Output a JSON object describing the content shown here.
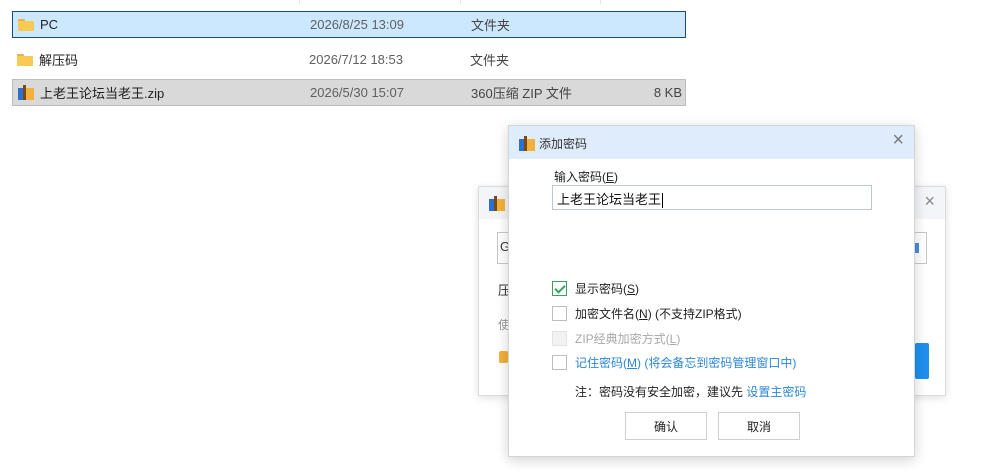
{
  "files": [
    {
      "name": "PC",
      "date": "2026/8/25 13:09",
      "type": "文件夹",
      "size": "",
      "icon": "folder-icon",
      "state": "selected"
    },
    {
      "name": "解压码",
      "date": "2026/7/12 18:53",
      "type": "文件夹",
      "size": "",
      "icon": "folder-icon",
      "state": "normal"
    },
    {
      "name": "上老王论坛当老王.zip",
      "date": "2026/5/30 15:07",
      "type": "360压缩 ZIP 文件",
      "size": "8 KB",
      "icon": "zip-archive-icon",
      "state": "hover"
    }
  ],
  "bg_dialog": {
    "close": "×",
    "input_partial": "G",
    "label_partial": "压",
    "hint_partial": "使"
  },
  "dialog": {
    "title": "添加密码",
    "close": "×",
    "password_label": "输入密码",
    "password_label_key": "E",
    "password_value": "上老王论坛当老王",
    "options": [
      {
        "text": "显示密码",
        "key": "S",
        "suffix": "",
        "checked": true,
        "disabled": false,
        "link": false
      },
      {
        "text": "加密文件名",
        "key": "N",
        "suffix": " (不支持ZIP格式)",
        "checked": false,
        "disabled": false,
        "link": false
      },
      {
        "text": "ZIP经典加密方式",
        "key": "L",
        "suffix": "",
        "checked": false,
        "disabled": true,
        "link": false
      },
      {
        "text": "记住密码",
        "key": "M",
        "suffix": " (将会备忘到密码管理窗口中)",
        "checked": false,
        "disabled": false,
        "link": true
      }
    ],
    "note_prefix": "注：密码没有安全加密，建议先 ",
    "note_link": "设置主密码",
    "ok_label": "确认",
    "cancel_label": "取消"
  },
  "colors": {
    "selected_bg": "#cce8ff",
    "hover_bg": "#d9d9d9",
    "dialog_title_bg": "#dfecfb",
    "link": "#2a86d8",
    "check_green": "#3aa35a"
  }
}
